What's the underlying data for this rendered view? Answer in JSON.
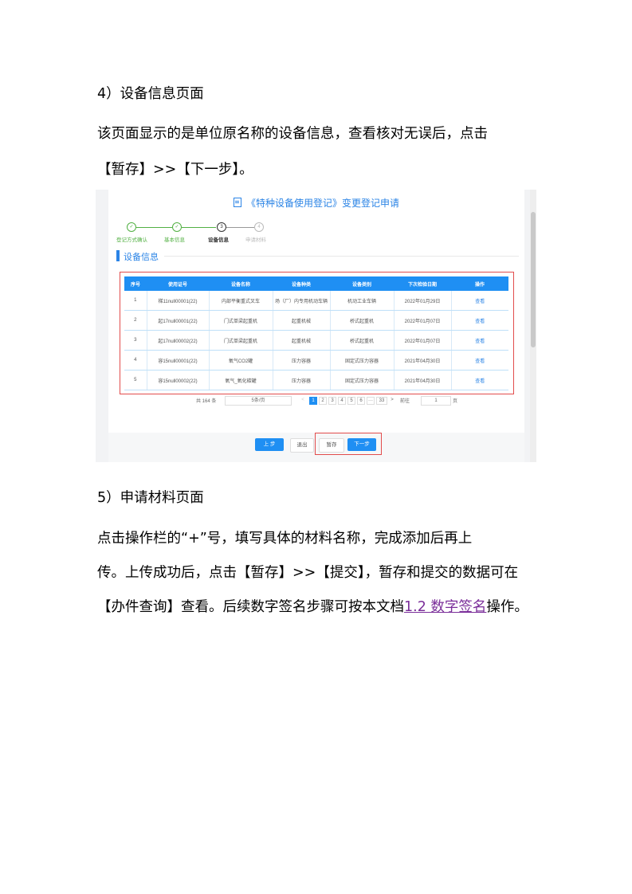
{
  "doc": {
    "heading4": "4）设备信息页面",
    "para4_line1": "该页面显示的是单位原名称的设备信息，查看核对无误后，点击",
    "para4_line2": "【暂存】>>【下一步】。",
    "heading5": "5）申请材料页面",
    "para5_line1": "点击操作栏的“+”号，填写具体的材料名称，完成添加后再上",
    "para5_line2": "传。上传成功后，点击【暂存】>>【提交】，暂存和提交的数据可在",
    "para5_line3_pre": "【办件查询】查看。后续数字签名步骤可按本文档",
    "para5_link": "1.2 数字签名",
    "para5_line3_post": "操作。"
  },
  "app": {
    "title": "《特种设备使用登记》变更登记申请",
    "steps": [
      {
        "num": "1",
        "label": "登记方式确认",
        "state": "done"
      },
      {
        "num": "2",
        "label": "基本信息",
        "state": "done"
      },
      {
        "num": "3",
        "label": "设备信息",
        "state": "current"
      },
      {
        "num": "4",
        "label": "申请材料",
        "state": "todo"
      }
    ],
    "section_title": "设备信息",
    "table": {
      "headers": [
        "序号",
        "使用证号",
        "设备名称",
        "设备种类",
        "设备类别",
        "下次检验日期",
        "操作"
      ],
      "rows": [
        [
          "1",
          "梯11null00001(22)",
          "内部平衡重式叉车",
          "场（厂）内专用机动车辆",
          "机动工业车辆",
          "2022年01月29日",
          "查看"
        ],
        [
          "2",
          "起17null00001(22)",
          "门式单梁起重机",
          "起重机械",
          "桥式起重机",
          "2022年01月07日",
          "查看"
        ],
        [
          "3",
          "起17null00002(22)",
          "门式单梁起重机",
          "起重机械",
          "桥式起重机",
          "2022年01月07日",
          "查看"
        ],
        [
          "4",
          "容15null00001(22)",
          "氧气CO2罐",
          "压力容器",
          "固定式压力容器",
          "2021年04月30日",
          "查看"
        ],
        [
          "5",
          "容15null00002(22)",
          "氧气_氧化碳罐",
          "压力容器",
          "固定式压力容器",
          "2021年04月30日",
          "查看"
        ]
      ]
    },
    "pager": {
      "total": "共 164 条",
      "page_size": "5条/页",
      "prev": "<",
      "pages": [
        "1",
        "2",
        "3",
        "4",
        "5",
        "6"
      ],
      "ellipsis": "···",
      "last": "33",
      "next": ">",
      "goto_label": "前往",
      "goto_value": "1",
      "page_unit": "页"
    },
    "buttons": {
      "prev_step": "上一步",
      "save_draft": "暂存",
      "next_step": "下一步",
      "nav_prev": "上 步",
      "nav_exit": "退出"
    },
    "colors": {
      "primary": "#1f8ff3",
      "done": "#52b043",
      "highlight": "#e24c4c",
      "link": "#7b2f9a"
    }
  }
}
